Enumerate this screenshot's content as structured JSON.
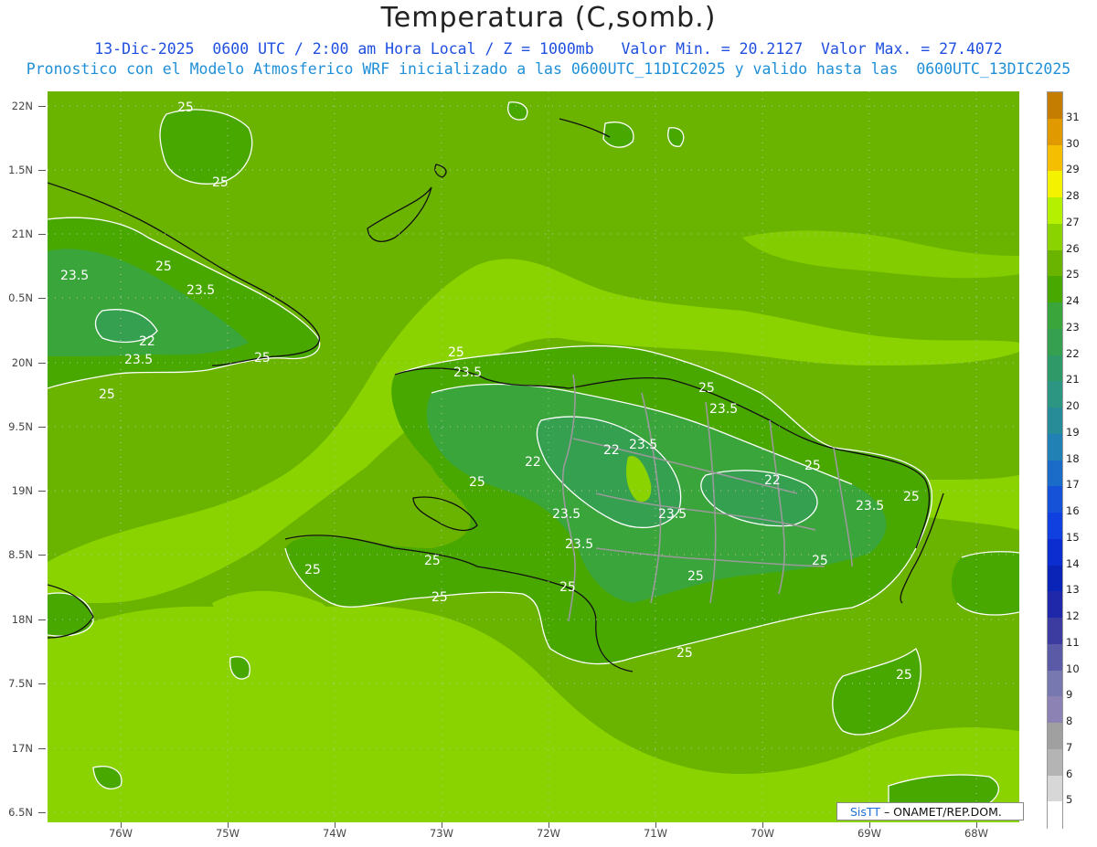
{
  "header": {
    "title": "Temperatura (C,somb.)",
    "line1": "13-Dic-2025  0600 UTC / 2:00 am Hora Local / Z = 1000mb   Valor Min. = 20.2127  Valor Max. = 27.4072",
    "line2": "Pronostico con el Modelo Atmosferico WRF inicializado a las 0600UTC_11DIC2025 y valido hasta las  0600UTC_13DIC2025"
  },
  "axes": {
    "lat_labels": [
      "22N",
      "1.5N",
      "21N",
      "0.5N",
      "20N",
      "9.5N",
      "19N",
      "8.5N",
      "18N",
      "7.5N",
      "17N",
      "6.5N"
    ],
    "lon_labels": [
      "76W",
      "75W",
      "74W",
      "73W",
      "72W",
      "71W",
      "70W",
      "69W",
      "68W"
    ]
  },
  "colorbar": {
    "labels": [
      "31",
      "30",
      "29",
      "28",
      "27",
      "26",
      "25",
      "24",
      "23",
      "22",
      "21",
      "20",
      "19",
      "18",
      "17",
      "16",
      "15",
      "14",
      "13",
      "12",
      "11",
      "10",
      "9",
      "8",
      "7",
      "6",
      "5"
    ],
    "colors": [
      "#c47d00",
      "#e09a00",
      "#f5be00",
      "#f5f200",
      "#b4f000",
      "#8ad200",
      "#6ab400",
      "#48a800",
      "#3aa53a",
      "#34a050",
      "#2f9a68",
      "#2c9683",
      "#278c98",
      "#2180b4",
      "#1a6cc8",
      "#1552d8",
      "#1040e0",
      "#0c2ed0",
      "#0a24b8",
      "#1f28a8",
      "#3c3ca0",
      "#5a5aa6",
      "#7878b0",
      "#8c82b4",
      "#a0a0a0",
      "#b4b4b4",
      "#d7d7d7",
      "#ffffff"
    ]
  },
  "contour_labels": [
    "25",
    "25",
    "25",
    "23.5",
    "23.5",
    "22",
    "23.5",
    "25",
    "25",
    "25",
    "23.5",
    "25",
    "22",
    "22",
    "23.5",
    "25",
    "23.5",
    "23.5",
    "23.5",
    "22",
    "25",
    "25",
    "23.5",
    "23.5",
    "25",
    "25",
    "25",
    "25",
    "25",
    "25",
    "25",
    "25"
  ],
  "credit": {
    "brand": "SisTT",
    "text": " – ONAMET/REP.DOM."
  },
  "colors": {
    "sea_dark": "#6ab400",
    "sea_light": "#8ad200",
    "land_mid": "#48a800",
    "land_cool": "#3aa53a",
    "land_coolest": "#34a050",
    "title_blue": "#1f4fe0",
    "subtitle_blue": "#1f8fd8"
  }
}
